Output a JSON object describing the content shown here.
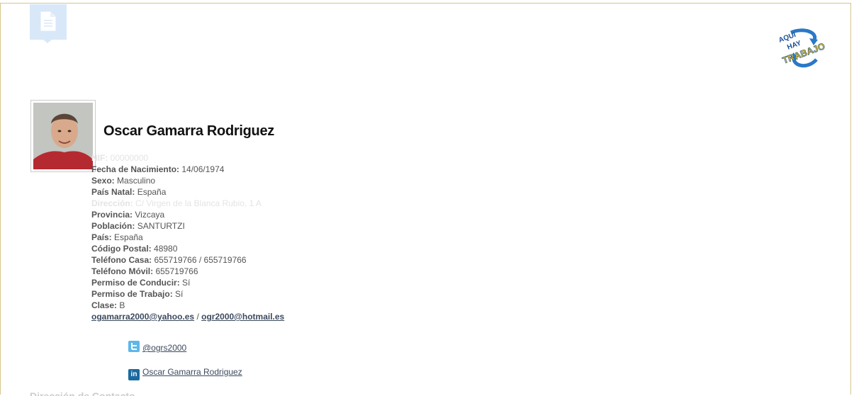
{
  "header": {
    "doc_icon": "document-icon",
    "logo_text": [
      "AQUI",
      "HAY",
      "TRABAJO"
    ]
  },
  "profile": {
    "name": "Oscar Gamarra Rodriguez",
    "photo_alt": "profile-photo"
  },
  "fields": {
    "nif": {
      "label": "NIF:",
      "value": "00000000"
    },
    "birth": {
      "label": "Fecha de Nacimiento:",
      "value": "14/06/1974"
    },
    "sex": {
      "label": "Sexo:",
      "value": "Masculino"
    },
    "birth_country": {
      "label": "País Natal:",
      "value": "España"
    },
    "address": {
      "label": "Dirección:",
      "value": "C/ Virgen de la Blanca Rubio, 1 A"
    },
    "province": {
      "label": "Provincia:",
      "value": "Vizcaya"
    },
    "town": {
      "label": "Población:",
      "value": "SANTURTZI"
    },
    "country": {
      "label": "País:",
      "value": "España"
    },
    "postal": {
      "label": "Código Postal:",
      "value": "48980"
    },
    "home_phone": {
      "label": "Teléfono Casa:",
      "value": "655719766 / 655719766"
    },
    "mobile_phone": {
      "label": "Teléfono Móvil:",
      "value": "655719766"
    },
    "driving_license": {
      "label": "Permiso de Conducir:",
      "value": "Sí"
    },
    "work_permit": {
      "label": "Permiso de Trabajo:",
      "value": "Sí"
    },
    "license_class": {
      "label": "Clase:",
      "value": "B"
    }
  },
  "emails": {
    "primary": "ogamarra2000@yahoo.es",
    "separator": "/",
    "secondary": "ogr2000@hotmail.es"
  },
  "social": {
    "twitter": {
      "icon": "twitter-icon",
      "handle": "@ogrs2000"
    },
    "linkedin": {
      "icon": "linkedin-icon",
      "name": "Oscar Gamarra Rodriguez"
    }
  },
  "section_next": "Dirección de Contacto",
  "colors": {
    "frame_border": "#d8c58a",
    "doc_tab": "#d9e8f8",
    "link": "#3c4a5e",
    "twitter": "#5fb7e8",
    "linkedin": "#1a6aa0"
  }
}
